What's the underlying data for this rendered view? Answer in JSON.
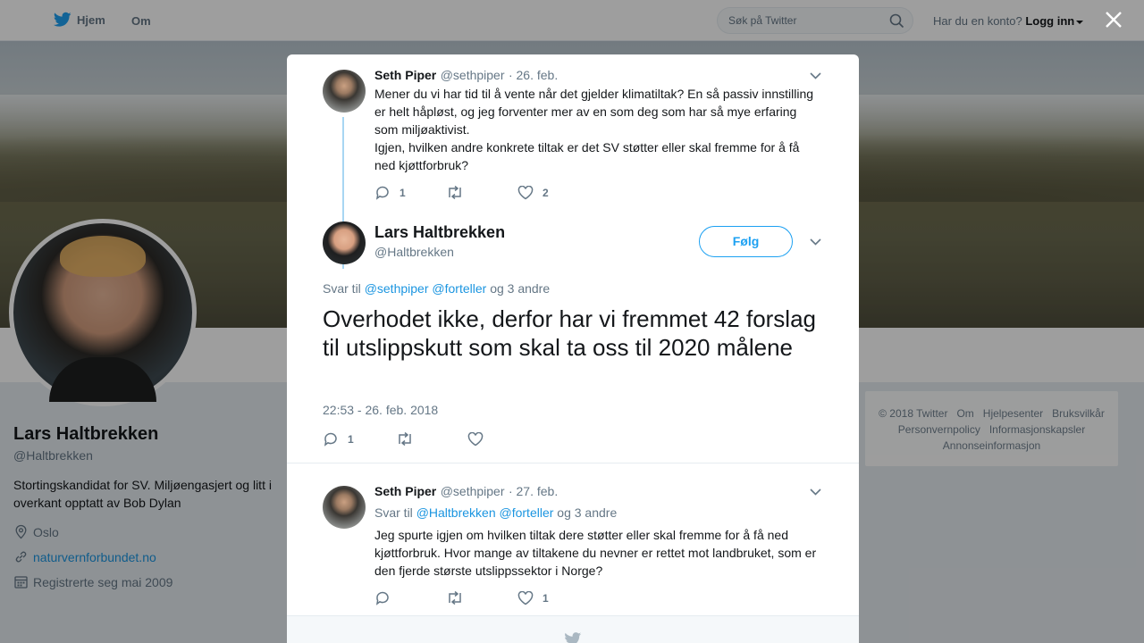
{
  "topbar": {
    "home_label": "Hjem",
    "about_label": "Om",
    "search_placeholder": "Søk på Twitter",
    "account_prompt": "Har du en konto?",
    "login_label": "Logg inn"
  },
  "profile": {
    "name": "Lars Haltbrekken",
    "handle": "@Haltbrekken",
    "bio": "Stortingskandidat for SV. Miljøengasjert og litt i overkant opptatt av Bob Dylan",
    "location": "Oslo",
    "website": "naturvernforbundet.no",
    "joined": "Registrerte seg mai 2009"
  },
  "footer": {
    "links": [
      "© 2018 Twitter",
      "Om",
      "Hjelpesenter",
      "Bruksvilkår",
      "Personvernpolicy",
      "Informasjonskapsler",
      "Annonseinformasjon"
    ]
  },
  "tweets": [
    {
      "name": "Seth Piper",
      "handle": "@sethpiper",
      "date": "· 26. feb.",
      "text_1": "Mener du vi har tid til å vente når det gjelder klimatiltak? En så passiv innstilling er helt håpløst, og jeg forventer mer av en som deg som har så mye erfaring som miljøaktivist.",
      "text_2": "Igjen, hvilken andre konkrete tiltak er det SV støtter eller skal fremme for å få ned kjøttforbruk?",
      "replies": "1",
      "likes": "2"
    },
    {
      "name": "Lars Haltbrekken",
      "handle": "@Haltbrekken",
      "follow_label": "Følg",
      "reply_prefix": "Svar til",
      "reply_user1": "@sethpiper",
      "reply_user2": "@forteller",
      "reply_suffix": "og 3 andre",
      "text": "Overhodet ikke, derfor har vi fremmet 42 forslag til utslippskutt som skal ta oss til 2020 målene",
      "timestamp": "22:53 - 26. feb. 2018",
      "replies": "1"
    },
    {
      "name": "Seth Piper",
      "handle": "@sethpiper",
      "date": "· 27. feb.",
      "reply_prefix": "Svar til",
      "reply_user1": "@Haltbrekken",
      "reply_user2": "@forteller",
      "reply_suffix": "og 3 andre",
      "text": "Jeg spurte igjen om hvilken tiltak dere støtter eller skal fremme for å få ned kjøttforbruk. Hvor mange av tiltakene du nevner er rettet mot landbruket, som er den fjerde største utslippssektor i Norge?",
      "likes": "1"
    }
  ],
  "colors": {
    "accent": "#1da1f2",
    "link": "#1b95e0",
    "muted": "#657786"
  }
}
